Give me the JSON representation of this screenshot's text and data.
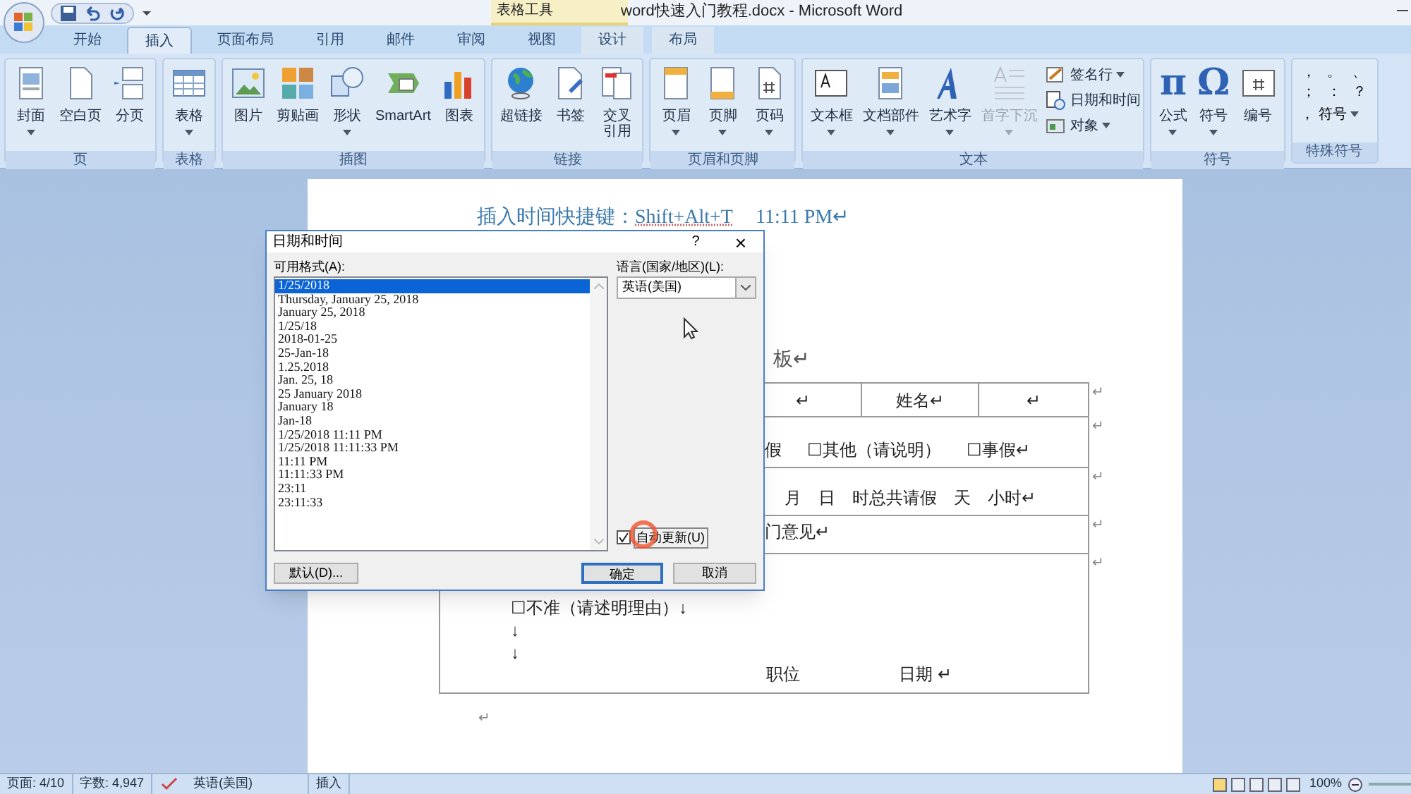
{
  "title_bar": {
    "title": "word快速入门教程.docx - Microsoft Word",
    "contextual_group": "表格工具"
  },
  "tabs": [
    {
      "label": "开始",
      "selected": false
    },
    {
      "label": "插入",
      "selected": true
    },
    {
      "label": "页面布局",
      "selected": false
    },
    {
      "label": "引用",
      "selected": false
    },
    {
      "label": "邮件",
      "selected": false
    },
    {
      "label": "审阅",
      "selected": false
    },
    {
      "label": "视图",
      "selected": false
    },
    {
      "label": "设计",
      "selected": false,
      "contextual": true
    },
    {
      "label": "布局",
      "selected": false,
      "contextual": true
    }
  ],
  "ribbon_groups": [
    {
      "label": "页",
      "buttons": [
        {
          "label": "封面",
          "dropdown": true,
          "disabled": false
        },
        {
          "label": "空白页",
          "dropdown": false,
          "disabled": false
        },
        {
          "label": "分页",
          "dropdown": false,
          "disabled": false
        }
      ]
    },
    {
      "label": "表格",
      "buttons": [
        {
          "label": "表格",
          "dropdown": true,
          "disabled": false
        }
      ]
    },
    {
      "label": "插图",
      "buttons": [
        {
          "label": "图片",
          "dropdown": false,
          "disabled": false
        },
        {
          "label": "剪贴画",
          "dropdown": false,
          "disabled": false
        },
        {
          "label": "形状",
          "dropdown": true,
          "disabled": false
        },
        {
          "label": "SmartArt",
          "dropdown": false,
          "disabled": false
        },
        {
          "label": "图表",
          "dropdown": false,
          "disabled": false
        }
      ]
    },
    {
      "label": "链接",
      "buttons": [
        {
          "label": "超链接",
          "dropdown": false,
          "disabled": false
        },
        {
          "label": "书签",
          "dropdown": false,
          "disabled": false
        },
        {
          "label": "交叉引用",
          "dropdown": false,
          "disabled": false
        }
      ]
    },
    {
      "label": "页眉和页脚",
      "buttons": [
        {
          "label": "页眉",
          "dropdown": true,
          "disabled": false
        },
        {
          "label": "页脚",
          "dropdown": true,
          "disabled": false
        },
        {
          "label": "页码",
          "dropdown": true,
          "disabled": false
        }
      ]
    },
    {
      "label": "文本",
      "buttons": [
        {
          "label": "文本框",
          "dropdown": true,
          "disabled": false
        },
        {
          "label": "文档部件",
          "dropdown": true,
          "disabled": false
        },
        {
          "label": "艺术字",
          "dropdown": true,
          "disabled": false
        },
        {
          "label": "首字下沉",
          "dropdown": true,
          "disabled": true
        }
      ],
      "small_buttons": [
        {
          "label": "签名行",
          "dropdown": true
        },
        {
          "label": "日期和时间",
          "dropdown": false
        },
        {
          "label": "对象",
          "dropdown": true
        }
      ]
    },
    {
      "label": "符号",
      "buttons": [
        {
          "label": "公式",
          "glyph": "π",
          "dropdown": true,
          "disabled": false
        },
        {
          "label": "符号",
          "glyph": "Ω",
          "dropdown": true,
          "disabled": false
        },
        {
          "label": "编号",
          "dropdown": false,
          "disabled": false
        }
      ]
    },
    {
      "label": "特殊符号",
      "symbols": [
        "，",
        "。",
        "、",
        "；",
        "：",
        "？"
      ],
      "symbol_button": {
        "glyph": "，",
        "label": "符号"
      }
    }
  ],
  "document": {
    "heading": "插入时间快捷键：",
    "shortcut": "Shift+Alt+T",
    "time": "11:11 PM↵",
    "title_fragment": "板↵",
    "rows": [
      {
        "cells": [
          "↵",
          "姓名↵",
          "↵"
        ],
        "mark": "↵"
      },
      {
        "texts": [
          "假",
          "☐其他（请说明）",
          "☐事假↵"
        ],
        "mark": "↵"
      },
      {
        "texts": [
          "月",
          "日",
          "时总共请假",
          "天",
          "小时↵"
        ],
        "mark": "↵"
      },
      {
        "texts": [
          "门意见↵"
        ],
        "mark": "↵"
      },
      {
        "lines": [
          "☐不准（请述明理由）↓",
          "↓",
          "↓"
        ],
        "signature": [
          "职位",
          "日期 ↵"
        ],
        "mark": "↵"
      }
    ],
    "after_table": "↵"
  },
  "dialog": {
    "title": "日期和时间",
    "help": "?",
    "close": "×",
    "formats_label": "可用格式(A):",
    "formats": [
      {
        "text": "1/25/2018",
        "selected": true
      },
      {
        "text": "Thursday, January 25, 2018",
        "selected": false
      },
      {
        "text": "January 25, 2018",
        "selected": false
      },
      {
        "text": "1/25/18",
        "selected": false
      },
      {
        "text": "2018-01-25",
        "selected": false
      },
      {
        "text": "25-Jan-18",
        "selected": false
      },
      {
        "text": "1.25.2018",
        "selected": false
      },
      {
        "text": "Jan. 25, 18",
        "selected": false
      },
      {
        "text": "25 January 2018",
        "selected": false
      },
      {
        "text": "January 18",
        "selected": false
      },
      {
        "text": "Jan-18",
        "selected": false
      },
      {
        "text": "1/25/2018 11:11 PM",
        "selected": false
      },
      {
        "text": "1/25/2018 11:11:33 PM",
        "selected": false
      },
      {
        "text": "11:11 PM",
        "selected": false
      },
      {
        "text": "11:11:33 PM",
        "selected": false
      },
      {
        "text": "23:11",
        "selected": false
      },
      {
        "text": "23:11:33",
        "selected": false
      }
    ],
    "language_label": "语言(国家/地区)(L):",
    "language": "英语(美国)",
    "auto_update": {
      "label": "自动更新(U)",
      "checked": true
    },
    "buttons": [
      {
        "label": "默认(D)...",
        "kind": "secondary"
      },
      {
        "label": "确定",
        "kind": "default"
      },
      {
        "label": "取消",
        "kind": "normal"
      }
    ]
  },
  "status_bar": {
    "page": "页面: 4/10",
    "words": "字数: 4,947",
    "language": "英语(美国)",
    "mode": "插入",
    "zoom": "100%"
  }
}
